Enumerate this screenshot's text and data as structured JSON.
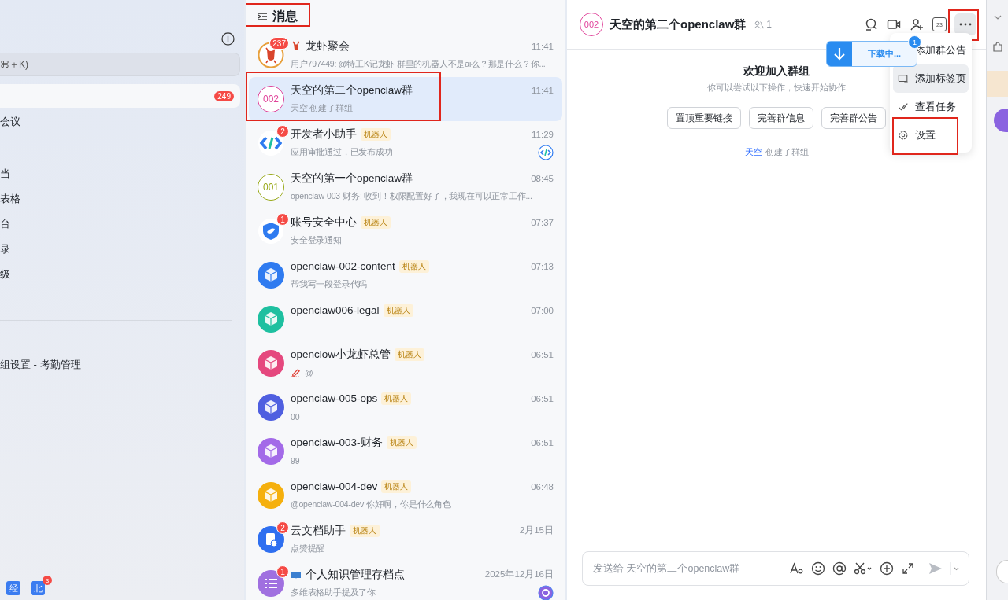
{
  "sidebar": {
    "search": {
      "placeholder": "⌘＋K)"
    },
    "groups": [
      [
        {
          "badge": "249",
          "selected": true
        },
        {
          "label": "会议",
          "selected": false
        }
      ],
      [
        {
          "label": "当",
          "selected": false
        },
        {
          "label": "表格",
          "selected": false
        },
        {
          "label": "台",
          "selected": false
        },
        {
          "label": "录",
          "selected": false
        },
        {
          "label": "级",
          "selected": false
        }
      ]
    ],
    "section_title": "组设置 - 考勤管理",
    "dock": [
      {
        "label": "经"
      },
      {
        "label": "北",
        "badge": "3"
      }
    ]
  },
  "chat_list": {
    "title": "消息",
    "highlighted": true,
    "chats": [
      {
        "name": "龙虾聚会",
        "avatar": {
          "kind": "lobster",
          "color": "#e8a03c"
        },
        "badge": "237",
        "time": "11:41",
        "preview": "用户797449: @特工K记龙虾 群里的机器人不是ai么？那是什么？你...",
        "draft": false,
        "selected": false,
        "highlighted": false
      },
      {
        "name": "天空的第二个openclaw群",
        "avatar": {
          "kind": "ring",
          "text": "002",
          "color": "#e0439a"
        },
        "time": "11:41",
        "preview": "天空 创建了群组",
        "draft": false,
        "selected": true,
        "highlighted": true
      },
      {
        "name": "开发者小助手",
        "avatar": {
          "kind": "code"
        },
        "badge": "2",
        "bot_tag": "机器人",
        "time": "11:29",
        "preview": "应用审批通过，已发布成功",
        "draft": false,
        "selected": false,
        "highlighted": false
      },
      {
        "name": "天空的第一个openclaw群",
        "avatar": {
          "kind": "ring",
          "text": "001",
          "color": "#9aaa1c"
        },
        "time": "08:45",
        "preview": "openclaw-003-财务: 收到！权限配置好了，我现在可以正常工作...",
        "draft": false,
        "selected": false,
        "highlighted": false
      },
      {
        "name": "账号安全中心",
        "avatar": {
          "kind": "shield",
          "color": "#2f7bf0"
        },
        "badge": "1",
        "bot_tag": "机器人",
        "time": "07:37",
        "preview": "安全登录通知",
        "draft": false,
        "selected": false,
        "highlighted": false
      },
      {
        "name": "openclaw-002-content",
        "avatar": {
          "kind": "cube",
          "color": "#2f7bf0"
        },
        "bot_tag": "机器人",
        "time": "07:13",
        "preview": "帮我写一段登录代码",
        "draft": false,
        "selected": false,
        "highlighted": false
      },
      {
        "name": "openclaw006-legal",
        "avatar": {
          "kind": "cube",
          "color": "#1ec0a0"
        },
        "bot_tag": "机器人",
        "time": "07:00",
        "draft": false,
        "selected": false,
        "highlighted": false
      },
      {
        "name": "openclow小龙虾总管",
        "avatar": {
          "kind": "cube",
          "color": "#e5487e"
        },
        "bot_tag": "机器人",
        "time": "06:51",
        "preview": "@",
        "draft": true,
        "selected": false,
        "highlighted": false
      },
      {
        "name": "openclaw-005-ops",
        "avatar": {
          "kind": "cube",
          "color": "#4f5fe0"
        },
        "bot_tag": "机器人",
        "time": "06:51",
        "preview": "00",
        "draft": false,
        "selected": false,
        "highlighted": false
      },
      {
        "name": "openclaw-003-财务",
        "avatar": {
          "kind": "cube",
          "color": "#a36ae8"
        },
        "bot_tag": "机器人",
        "time": "06:51",
        "preview": "99",
        "draft": false,
        "selected": false,
        "highlighted": false
      },
      {
        "name": "openclaw-004-dev",
        "avatar": {
          "kind": "cube",
          "color": "#f5b00e"
        },
        "bot_tag": "机器人",
        "time": "06:48",
        "preview": "@openclaw-004-dev 你好啊，你是什么角色",
        "draft": false,
        "selected": false,
        "highlighted": false
      },
      {
        "name": "云文档助手",
        "avatar": {
          "kind": "doc",
          "color": "#2f6ff0"
        },
        "badge": "2",
        "bot_tag": "机器人",
        "time": "2月15日",
        "preview": "点赞提醒",
        "draft": false,
        "selected": false,
        "highlighted": false
      },
      {
        "name": "个人知识管理存档点",
        "avatar": {
          "kind": "list",
          "color": "#a070e0"
        },
        "badge": "1",
        "time": "2025年12月16日",
        "preview": "多维表格助手提及了你",
        "draft": false,
        "selected": false,
        "highlighted": false
      }
    ]
  },
  "chat": {
    "avatar": {
      "text": "002",
      "color": "#e0439a"
    },
    "title": "天空的第二个openclaw群",
    "member_count": "1",
    "calendar_day": "23",
    "more": {
      "highlighted": true
    },
    "menu": {
      "items": [
        {
          "kind": "announcement",
          "label": "添加群公告",
          "selected": false,
          "highlighted": false
        },
        {
          "kind": "tab",
          "label": "添加标签页",
          "selected": true,
          "highlighted": false
        },
        {
          "kind": "tasks",
          "label": "查看任务",
          "selected": false,
          "highlighted": false
        },
        {
          "kind": "settings",
          "label": "设置",
          "selected": false,
          "highlighted": true
        }
      ]
    },
    "toast": {
      "text": "下载中...",
      "badge": "1"
    },
    "welcome": {
      "title": "欢迎加入群组",
      "subtitle": "你可以尝试以下操作，快速开始协作",
      "actions": [
        "置顶重要链接",
        "完善群信息",
        "完善群公告"
      ]
    },
    "system_message": {
      "actor": "天空",
      "text": "创建了群组"
    },
    "composer": {
      "placeholder": "发送给 天空的第二个openclaw群"
    }
  }
}
